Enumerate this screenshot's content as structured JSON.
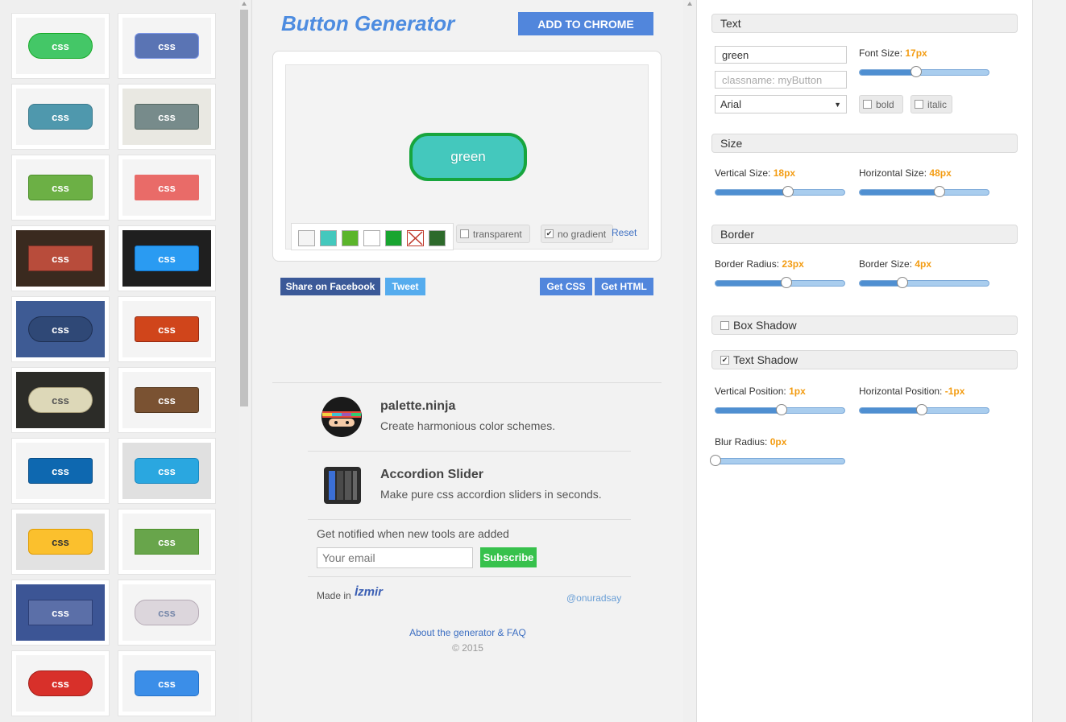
{
  "gallery": {
    "tiles": [
      {
        "label": "css",
        "bg": "#44c767",
        "border": "#18ab29",
        "radius": "18px",
        "bgArea": "#f4f4f4",
        "text": "#ffffff"
      },
      {
        "label": "css",
        "bg": "#5a74b4",
        "border": "#7b95e6",
        "radius": "6px",
        "bgArea": "#f4f4f4",
        "text": "#ffffff"
      },
      {
        "label": "css",
        "bg": "#4f98ad",
        "border": "#3c7a8d",
        "radius": "8px",
        "bgArea": "#f4f4f4",
        "text": "#ffffff"
      },
      {
        "label": "css",
        "bg": "#778b8b",
        "border": "#566963",
        "radius": "3px",
        "bgArea": "#e9e8e2",
        "text": "#ffffff"
      },
      {
        "label": "css",
        "bg": "#6cb045",
        "border": "#4b8f29",
        "radius": "4px",
        "bgArea": "#f4f4f4",
        "text": "#ffffff"
      },
      {
        "label": "css",
        "bg": "#e96b68",
        "border": "#e96b68",
        "radius": "2px",
        "bgArea": "#f4f4f4",
        "text": "#ffffff"
      },
      {
        "label": "css",
        "bg": "#b84c3b",
        "border": "#7c3026",
        "radius": "0px",
        "bgArea": "#3a2a1f",
        "text": "#ffffff"
      },
      {
        "label": "css",
        "bg": "#2a9bf2",
        "border": "#0b78d6",
        "radius": "3px",
        "bgArea": "#1f1f1f",
        "text": "#ffffff"
      },
      {
        "label": "css",
        "bg": "#2f4876",
        "border": "#1e2f52",
        "radius": "18px",
        "bgArea": "#3e5b94",
        "text": "#ffffff"
      },
      {
        "label": "css",
        "bg": "#d0451b",
        "border": "#942911",
        "radius": "3px",
        "bgArea": "#f4f4f4",
        "text": "#ffffff"
      },
      {
        "label": "css",
        "bg": "#ddd8b8",
        "border": "#a89e7a",
        "radius": "16px",
        "bgArea": "#2c2c28",
        "text": "#555555"
      },
      {
        "label": "css",
        "bg": "#7a5232",
        "border": "#54381f",
        "radius": "3px",
        "bgArea": "#f4f4f4",
        "text": "#ffffff"
      },
      {
        "label": "css",
        "bg": "#0e68b0",
        "border": "#0b4e86",
        "radius": "3px",
        "bgArea": "#f4f4f4",
        "text": "#ffffff"
      },
      {
        "label": "css",
        "bg": "#2aa7e0",
        "border": "#1687c0",
        "radius": "5px",
        "bgArea": "#e0e0e0",
        "text": "#ffffff"
      },
      {
        "label": "css",
        "bg": "#fbc02d",
        "border": "#e09b00",
        "radius": "6px",
        "bgArea": "#e2e2e2",
        "text": "#333333"
      },
      {
        "label": "css",
        "bg": "#68a54b",
        "border": "#4b8f29",
        "radius": "0px",
        "bgArea": "#f4f4f4",
        "text": "#ffffff"
      },
      {
        "label": "css",
        "bg": "#5b6fa8",
        "border": "#2c3e75",
        "radius": "0px",
        "bgArea": "#3c5595",
        "text": "#ffffff"
      },
      {
        "label": "css",
        "bg": "#dcd6dc",
        "border": "#b5aab5",
        "radius": "14px",
        "bgArea": "#f4f4f4",
        "text": "#7788aa"
      },
      {
        "label": "css",
        "bg": "#d8302a",
        "border": "#a01e18",
        "radius": "16px",
        "bgArea": "#f4f4f4",
        "text": "#ffffff"
      },
      {
        "label": "css",
        "bg": "#3b8ee8",
        "border": "#2471c8",
        "radius": "5px",
        "bgArea": "#f4f4f4",
        "text": "#ffffff"
      }
    ]
  },
  "header": {
    "title": "Button Generator",
    "add_chrome_label": "ADD TO CHROME"
  },
  "preview": {
    "button_text": "green",
    "swatches": [
      "#f4f4f4",
      "#44c8bd",
      "#5bb52b",
      "#ffffff",
      "#18a530",
      "none",
      "#2d6a2b"
    ],
    "transparent_label": "transparent",
    "no_gradient_label": "no gradient",
    "no_gradient_checked": "✔",
    "reset_label": "Reset"
  },
  "share": {
    "facebook": "Share on Facebook",
    "tweet": "Tweet",
    "get_css": "Get CSS",
    "get_html": "Get HTML"
  },
  "promos": [
    {
      "title": "palette.ninja",
      "desc": "Create harmonious color schemes.",
      "icon": "ninja-icon"
    },
    {
      "title": "Accordion Slider",
      "desc": "Make pure css accordion sliders in seconds.",
      "icon": "accordion-icon"
    }
  ],
  "newsletter": {
    "text": "Get notified when new tools are added",
    "placeholder": "Your email",
    "subscribe": "Subscribe"
  },
  "footer": {
    "made_in": "Made in",
    "logo_text": "İzmir",
    "handle": "@onuradsay",
    "faq": "About the generator & FAQ",
    "copyright": "© 2015"
  },
  "panel": {
    "text": {
      "header": "Text",
      "text_value": "green",
      "classname_placeholder": "classname: myButton",
      "font": "Arial",
      "font_size_label": "Font Size:",
      "font_size_value": "17px",
      "font_size_fraction": 0.44,
      "bold": "bold",
      "italic": "italic"
    },
    "size": {
      "header": "Size",
      "vertical_label": "Vertical Size:",
      "vertical_value": "18px",
      "vertical_fraction": 0.56,
      "horizontal_label": "Horizontal Size:",
      "horizontal_value": "48px",
      "horizontal_fraction": 0.62
    },
    "border": {
      "header": "Border",
      "radius_label": "Border Radius:",
      "radius_value": "23px",
      "radius_fraction": 0.55,
      "size_label": "Border Size:",
      "size_value": "4px",
      "size_fraction": 0.33
    },
    "box_shadow": {
      "header": "Box Shadow"
    },
    "text_shadow": {
      "header": "Text Shadow",
      "checked": "✔",
      "vpos_label": "Vertical Position:",
      "vpos_value": "1px",
      "vpos_fraction": 0.51,
      "hpos_label": "Horizontal Position:",
      "hpos_value": "-1px",
      "hpos_fraction": 0.48,
      "blur_label": "Blur Radius:",
      "blur_value": "0px",
      "blur_fraction": 0.0
    }
  }
}
